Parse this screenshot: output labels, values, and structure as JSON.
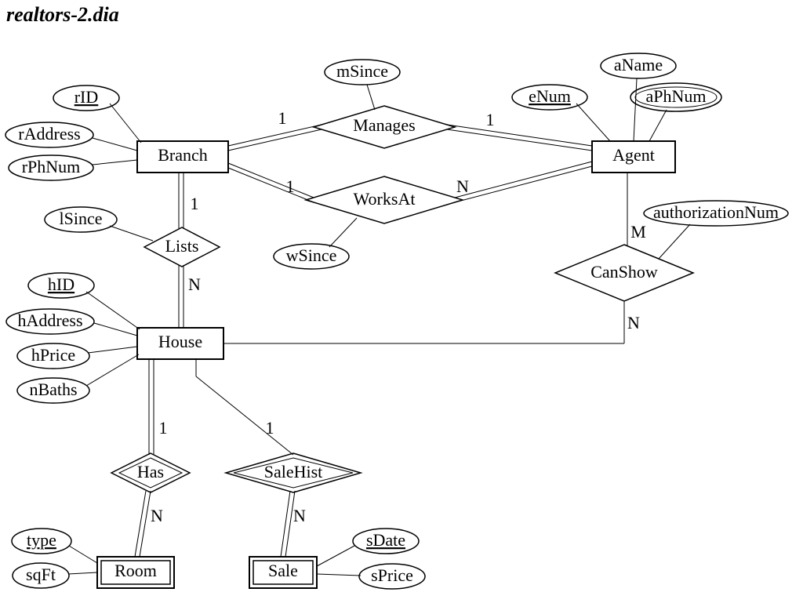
{
  "title": "realtors-2.dia",
  "entities": {
    "branch": "Branch",
    "agent": "Agent",
    "house": "House",
    "room": "Room",
    "sale": "Sale"
  },
  "relationships": {
    "manages": "Manages",
    "worksAt": "WorksAt",
    "lists": "Lists",
    "canShow": "CanShow",
    "has": "Has",
    "saleHist": "SaleHist"
  },
  "attributes": {
    "rID": "rID",
    "rAddress": "rAddress",
    "rPhNum": "rPhNum",
    "mSince": "mSince",
    "eNum": "eNum",
    "aName": "aName",
    "aPhNum": "aPhNum",
    "wSince": "wSince",
    "lSince": "lSince",
    "authorizationNum": "authorizationNum",
    "hID": "hID",
    "hAddress": "hAddress",
    "hPrice": "hPrice",
    "nBaths": "nBaths",
    "type": "type",
    "sqFt": "sqFt",
    "sDate": "sDate",
    "sPrice": "sPrice"
  },
  "cardinalities": {
    "manages_branch": "1",
    "manages_agent": "1",
    "worksAt_branch": "1",
    "worksAt_agent": "N",
    "lists_branch": "1",
    "lists_house": "N",
    "canShow_agent": "M",
    "canShow_house": "N",
    "has_house": "1",
    "has_room": "N",
    "saleHist_house": "1",
    "saleHist_sale": "N"
  }
}
